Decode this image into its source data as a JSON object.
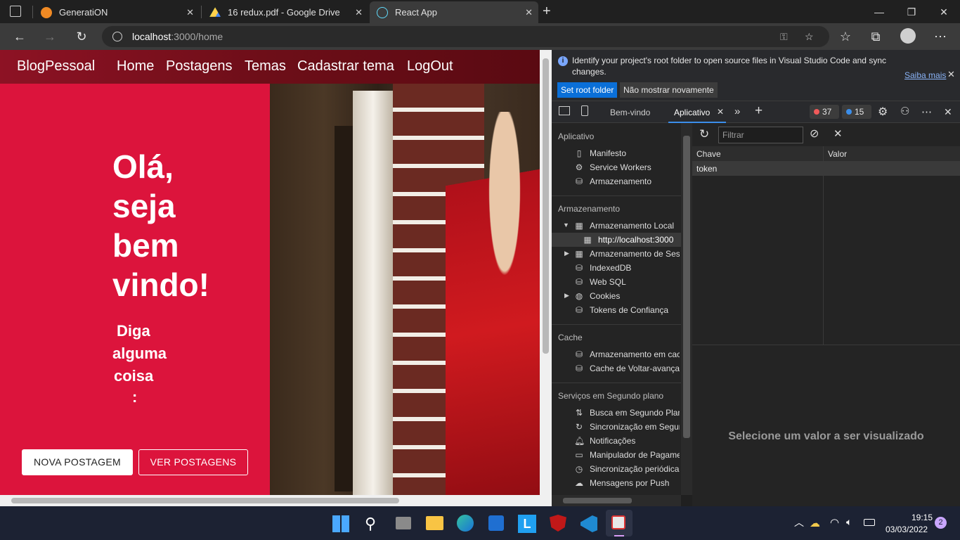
{
  "browser": {
    "tabs": [
      {
        "title": "GeneratiON",
        "icon": "cloud-icon"
      },
      {
        "title": "16 redux.pdf - Google Drive",
        "icon": "google-drive-icon"
      },
      {
        "title": "React App",
        "icon": "react-icon"
      }
    ],
    "address": {
      "host": "localhost",
      "path": ":3000/home"
    }
  },
  "page": {
    "nav": {
      "brand": "BlogPessoal",
      "links": [
        "Home",
        "Postagens",
        "Temas",
        "Cadastrar tema",
        "LogOut"
      ]
    },
    "hero": {
      "title_lines": [
        "Olá,",
        "seja",
        "bem",
        "vindo!"
      ],
      "subtitle_lines": [
        "Diga",
        "alguma",
        "coisa",
        ":"
      ],
      "btn_new": "NOVA POSTAGEM",
      "btn_view": "VER POSTAGENS"
    },
    "colors": {
      "brand_red": "#dc143c",
      "appbar": "#8d1224"
    }
  },
  "devtools": {
    "info": {
      "message": "Identify your project's root folder to open source files in Visual Studio Code and sync changes.",
      "learn_more": "Saiba mais",
      "btn_set_root": "Set root folder",
      "btn_dismiss": "Não mostrar novamente"
    },
    "tabs": {
      "welcome": "Bem-vindo",
      "app": "Aplicativo",
      "errors": "37",
      "messages": "15"
    },
    "sidebar": {
      "app_header": "Aplicativo",
      "app_items": [
        "Manifesto",
        "Service Workers",
        "Armazenamento"
      ],
      "storage_header": "Armazenamento",
      "storage_items": [
        "Armazenamento Local",
        "http://localhost:3000",
        "Armazenamento de Sessão",
        "IndexedDB",
        "Web SQL",
        "Cookies",
        "Tokens de Confiança"
      ],
      "cache_header": "Cache",
      "cache_items": [
        "Armazenamento em cache",
        "Cache de Voltar-avançar"
      ],
      "bg_header": "Serviços em Segundo plano",
      "bg_items": [
        "Busca em Segundo Plano",
        "Sincronização em Segundo Plano",
        "Notificações",
        "Manipulador de Pagamentos",
        "Sincronização periódica",
        "Mensagens por Push"
      ]
    },
    "main": {
      "filter_placeholder": "Filtrar",
      "col_key": "Chave",
      "col_value": "Valor",
      "row_key": "token",
      "row_value": "",
      "empty_message": "Selecione um valor a ser visualizado"
    }
  },
  "taskbar": {
    "time": "19:15",
    "date": "03/03/2022",
    "notifications": "2"
  }
}
